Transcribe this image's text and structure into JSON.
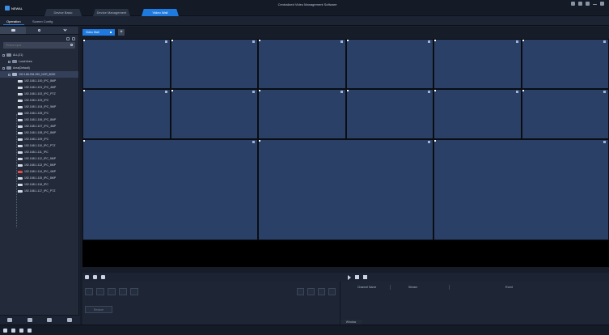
{
  "app": {
    "logo_text": "NEWAL",
    "title": "Centralized Video Management Software",
    "brand_color": "#1f7ae0"
  },
  "main_tabs": [
    {
      "label": "Device Basic",
      "active": false
    },
    {
      "label": "Device Management",
      "active": false
    },
    {
      "label": "Video Wall",
      "active": true
    }
  ],
  "sub_tabs": [
    {
      "label": "Operation",
      "active": true
    },
    {
      "label": "Screen Config",
      "active": false
    }
  ],
  "sidebar": {
    "search_placeholder": "Please input",
    "tree": [
      {
        "label": "ALL(21)",
        "level": 0,
        "icon": "folder-icon"
      },
      {
        "label": "Local Area",
        "level": 1,
        "icon": "folder-icon"
      },
      {
        "label": "Area(Default)",
        "level": 0,
        "icon": "folder-icon"
      },
      {
        "label": "192.168.254.250_NVR_8000",
        "level": 1,
        "icon": "nvr-icon",
        "selected": true
      },
      {
        "label": "192.168.1.100_IPC_8MP",
        "level": 2,
        "icon": "camera-icon"
      },
      {
        "label": "192.168.1.101_IPC_4MP",
        "level": 2,
        "icon": "camera-icon"
      },
      {
        "label": "192.168.1.102_IPC_PTZ",
        "level": 2,
        "icon": "camera-icon"
      },
      {
        "label": "192.168.1.103_IPC",
        "level": 2,
        "icon": "camera-icon"
      },
      {
        "label": "192.168.1.104_IPC_5MP",
        "level": 2,
        "icon": "camera-icon"
      },
      {
        "label": "192.168.1.105_IPC",
        "level": 2,
        "icon": "camera-icon"
      },
      {
        "label": "192.168.1.106_IPC_8MP",
        "level": 2,
        "icon": "camera-icon"
      },
      {
        "label": "192.168.1.107_IPC_4MP",
        "level": 2,
        "icon": "camera-icon"
      },
      {
        "label": "192.168.1.108_IPC_8MP",
        "level": 2,
        "icon": "camera-icon"
      },
      {
        "label": "192.168.1.109_IPC",
        "level": 2,
        "icon": "camera-icon"
      },
      {
        "label": "192.168.1.110_IPC_PTZ",
        "level": 2,
        "icon": "camera-icon"
      },
      {
        "label": "192.168.1.111_IPC",
        "level": 2,
        "icon": "camera-icon"
      },
      {
        "label": "192.168.1.112_IPC_5MP",
        "level": 2,
        "icon": "camera-icon"
      },
      {
        "label": "192.168.1.113_IPC_8MP",
        "level": 2,
        "icon": "camera-icon"
      },
      {
        "label": "192.168.1.114_IPC_4MP",
        "level": 2,
        "icon": "camera-icon",
        "offline": true
      },
      {
        "label": "192.168.1.115_IPC_8MP",
        "level": 2,
        "icon": "camera-icon"
      },
      {
        "label": "192.168.1.116_IPC",
        "level": 2,
        "icon": "camera-icon"
      },
      {
        "label": "192.168.1.117_IPC_PTZ",
        "level": 2,
        "icon": "camera-icon"
      }
    ]
  },
  "wall_tabs": [
    {
      "label": "Video Wall",
      "active": true
    }
  ],
  "controls": {
    "restore_label": "Restore",
    "window_label": "Window"
  },
  "table": {
    "columns": [
      "Channel Name",
      "Stream",
      "Event"
    ]
  }
}
